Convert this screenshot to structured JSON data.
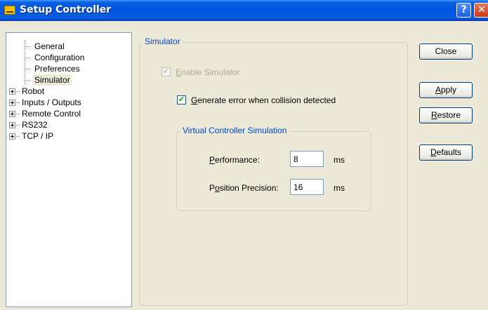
{
  "window": {
    "title": "Setup Controller",
    "help_label": "?",
    "close_label": "✕"
  },
  "tree": {
    "items": [
      {
        "label": "General"
      },
      {
        "label": "Configuration"
      },
      {
        "label": "Preferences"
      },
      {
        "label": "Simulator",
        "selected": true
      },
      {
        "label": "Robot",
        "expandable": true
      },
      {
        "label": "Inputs / Outputs",
        "expandable": true
      },
      {
        "label": "Remote Control",
        "expandable": true
      },
      {
        "label": "RS232",
        "expandable": true
      },
      {
        "label": "TCP / IP",
        "expandable": true
      }
    ]
  },
  "simulator": {
    "legend": "Simulator",
    "enable_simulator": {
      "label_key": "E",
      "label_rest": "nable Simulator",
      "checked": true,
      "disabled": true
    },
    "generate_error": {
      "label_key": "G",
      "label_rest": "enerate error when collision detected",
      "checked": true
    },
    "virtual": {
      "legend": "Virtual Controller Simulation",
      "performance": {
        "label_key": "P",
        "label_rest": "erformance:",
        "value": "8",
        "unit": "ms"
      },
      "position_precision": {
        "label_pre": "P",
        "label_key": "o",
        "label_rest": "sition Precision:",
        "value": "16",
        "unit": "ms"
      }
    }
  },
  "buttons": {
    "close": "Close",
    "apply_key": "A",
    "apply_rest": "pply",
    "restore_key": "R",
    "restore_rest": "estore",
    "defaults_key": "D",
    "defaults_rest": "efaults"
  },
  "colors": {
    "titlebar": "#0054e3",
    "dialog_bg": "#ece9d8",
    "group_legend": "#0046d5"
  }
}
